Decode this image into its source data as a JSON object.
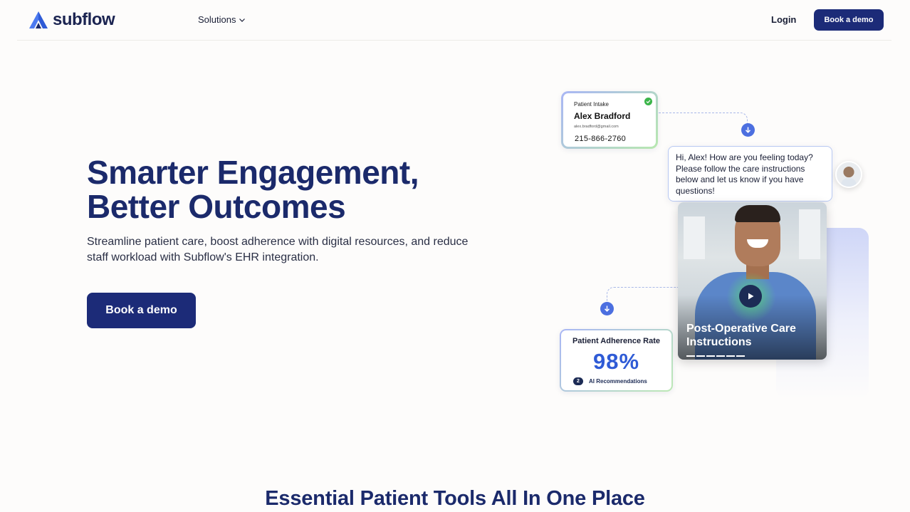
{
  "header": {
    "logo_text": "subflow",
    "nav_solutions": "Solutions",
    "login": "Login",
    "book_demo": "Book a demo"
  },
  "hero": {
    "title": "Smarter Engagement, Better Outcomes",
    "subtitle": "Streamline patient care, boost adherence with digital resources, and reduce staff workload with Subflow's EHR integration.",
    "cta": "Book a demo"
  },
  "illustration": {
    "intake": {
      "label": "Patient Intake",
      "name": "Alex Bradford",
      "email": "alex.bradford@gmail.com",
      "phone": "215-866-2760"
    },
    "chat_message": "Hi, Alex! How are you feeling today? Please follow the care instructions below and let us know if you have questions!",
    "video_title": "Post-Operative Care Instructions",
    "adherence": {
      "label": "Patient Adherence Rate",
      "value": "98%",
      "badge": "2",
      "recommendations": "AI Recommendations"
    }
  },
  "section_title": "Essential Patient Tools All In One Place",
  "colors": {
    "brand_navy": "#1c2b78",
    "heading_navy": "#1b2a6b",
    "accent_blue": "#2f5bd6",
    "success_green": "#3cb54a"
  },
  "icons": [
    "logo-mark-icon",
    "chevron-down-icon",
    "arrow-down-icon",
    "check-icon",
    "play-icon"
  ]
}
